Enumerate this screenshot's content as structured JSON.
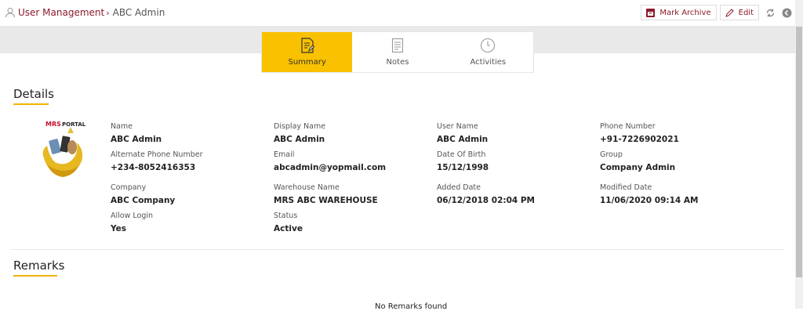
{
  "breadcrumb": {
    "parent": "User Management",
    "separator": "›",
    "current": "ABC Admin"
  },
  "actions": {
    "archive_label": "Mark Archive",
    "edit_label": "Edit"
  },
  "tabs": [
    {
      "label": "Summary",
      "active": true
    },
    {
      "label": "Notes",
      "active": false
    },
    {
      "label": "Activities",
      "active": false
    }
  ],
  "details": {
    "title": "Details",
    "logo_text": "MRS PORTAL",
    "fields": [
      {
        "label": "Name",
        "value": "ABC Admin"
      },
      {
        "label": "Display Name",
        "value": "ABC Admin"
      },
      {
        "label": "User Name",
        "value": "ABC Admin"
      },
      {
        "label": "Phone Number",
        "value": "+91-7226902021"
      },
      {
        "label": "Alternate Phone Number",
        "value": "+234-8052416353"
      },
      {
        "label": "Email",
        "value": "abcadmin@yopmail.com"
      },
      {
        "label": "Date Of Birth",
        "value": "15/12/1998"
      },
      {
        "label": "Group",
        "value": "Company Admin"
      },
      {
        "label": "Company",
        "value": "ABC Company"
      },
      {
        "label": "Warehouse Name",
        "value": "MRS ABC WAREHOUSE"
      },
      {
        "label": "Added Date",
        "value": "06/12/2018 02:04 PM"
      },
      {
        "label": "Modified Date",
        "value": "11/06/2020 09:14 AM"
      },
      {
        "label": "Allow Login",
        "value": "Yes"
      },
      {
        "label": "Status",
        "value": "Active"
      }
    ]
  },
  "remarks": {
    "title": "Remarks",
    "empty_text": "No Remarks found"
  },
  "colors": {
    "brand": "#8b1a2b",
    "accent": "#f9c100"
  }
}
